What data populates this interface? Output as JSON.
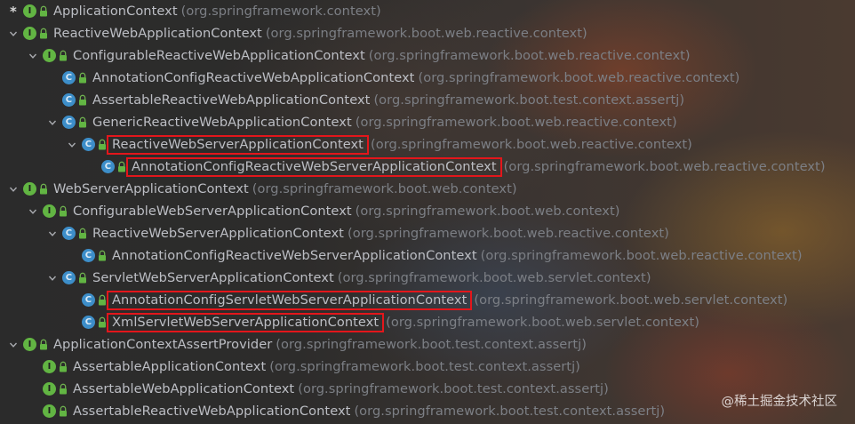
{
  "rows": [
    {
      "name": "ApplicationContext",
      "pkg": "(org.springframework.context)",
      "kind": "I",
      "depth": 0,
      "marker": "star",
      "highlight": false
    },
    {
      "name": "ReactiveWebApplicationContext",
      "pkg": "(org.springframework.boot.web.reactive.context)",
      "kind": "I",
      "depth": 0,
      "marker": "expanded",
      "highlight": false
    },
    {
      "name": "ConfigurableReactiveWebApplicationContext",
      "pkg": "(org.springframework.boot.web.reactive.context)",
      "kind": "I",
      "depth": 1,
      "marker": "expanded",
      "highlight": false
    },
    {
      "name": "AnnotationConfigReactiveWebApplicationContext",
      "pkg": "(org.springframework.boot.web.reactive.context)",
      "kind": "C",
      "depth": 2,
      "marker": "none",
      "highlight": false
    },
    {
      "name": "AssertableReactiveWebApplicationContext",
      "pkg": "(org.springframework.boot.test.context.assertj)",
      "kind": "C",
      "depth": 2,
      "marker": "none",
      "highlight": false
    },
    {
      "name": "GenericReactiveWebApplicationContext",
      "pkg": "(org.springframework.boot.web.reactive.context)",
      "kind": "C",
      "depth": 2,
      "marker": "expanded",
      "highlight": false
    },
    {
      "name": "ReactiveWebServerApplicationContext",
      "pkg": "(org.springframework.boot.web.reactive.context)",
      "kind": "C",
      "depth": 3,
      "marker": "expanded",
      "highlight": true
    },
    {
      "name": "AnnotationConfigReactiveWebServerApplicationContext",
      "pkg": "(org.springframework.boot.web.reactive.context)",
      "kind": "C",
      "depth": 4,
      "marker": "none",
      "highlight": true
    },
    {
      "name": "WebServerApplicationContext",
      "pkg": "(org.springframework.boot.web.context)",
      "kind": "I",
      "depth": 0,
      "marker": "expanded",
      "highlight": false
    },
    {
      "name": "ConfigurableWebServerApplicationContext",
      "pkg": "(org.springframework.boot.web.context)",
      "kind": "I",
      "depth": 1,
      "marker": "expanded",
      "highlight": false
    },
    {
      "name": "ReactiveWebServerApplicationContext",
      "pkg": "(org.springframework.boot.web.reactive.context)",
      "kind": "C",
      "depth": 2,
      "marker": "expanded",
      "highlight": false
    },
    {
      "name": "AnnotationConfigReactiveWebServerApplicationContext",
      "pkg": "(org.springframework.boot.web.reactive.context)",
      "kind": "C",
      "depth": 3,
      "marker": "none",
      "highlight": false
    },
    {
      "name": "ServletWebServerApplicationContext",
      "pkg": "(org.springframework.boot.web.servlet.context)",
      "kind": "C",
      "depth": 2,
      "marker": "expanded",
      "highlight": false
    },
    {
      "name": "AnnotationConfigServletWebServerApplicationContext",
      "pkg": "(org.springframework.boot.web.servlet.context)",
      "kind": "C",
      "depth": 3,
      "marker": "none",
      "highlight": true
    },
    {
      "name": "XmlServletWebServerApplicationContext",
      "pkg": "(org.springframework.boot.web.servlet.context)",
      "kind": "C",
      "depth": 3,
      "marker": "none",
      "highlight": true
    },
    {
      "name": "ApplicationContextAssertProvider",
      "pkg": "(org.springframework.boot.test.context.assertj)",
      "kind": "I",
      "depth": 0,
      "marker": "expanded",
      "highlight": false
    },
    {
      "name": "AssertableApplicationContext",
      "pkg": "(org.springframework.boot.test.context.assertj)",
      "kind": "I",
      "depth": 1,
      "marker": "none",
      "highlight": false
    },
    {
      "name": "AssertableWebApplicationContext",
      "pkg": "(org.springframework.boot.test.context.assertj)",
      "kind": "I",
      "depth": 1,
      "marker": "none",
      "highlight": false
    },
    {
      "name": "AssertableReactiveWebApplicationContext",
      "pkg": "(org.springframework.boot.test.context.assertj)",
      "kind": "I",
      "depth": 1,
      "marker": "none",
      "highlight": false
    }
  ],
  "icons": {
    "I": "interface-icon",
    "C": "class-icon",
    "lock": "lock-icon",
    "expanded": "chevron-down-icon"
  },
  "colors": {
    "highlight": "#e3161b",
    "interface": "#62b543",
    "class": "#3d8ec9"
  },
  "watermark": "@稀土掘金技术社区"
}
